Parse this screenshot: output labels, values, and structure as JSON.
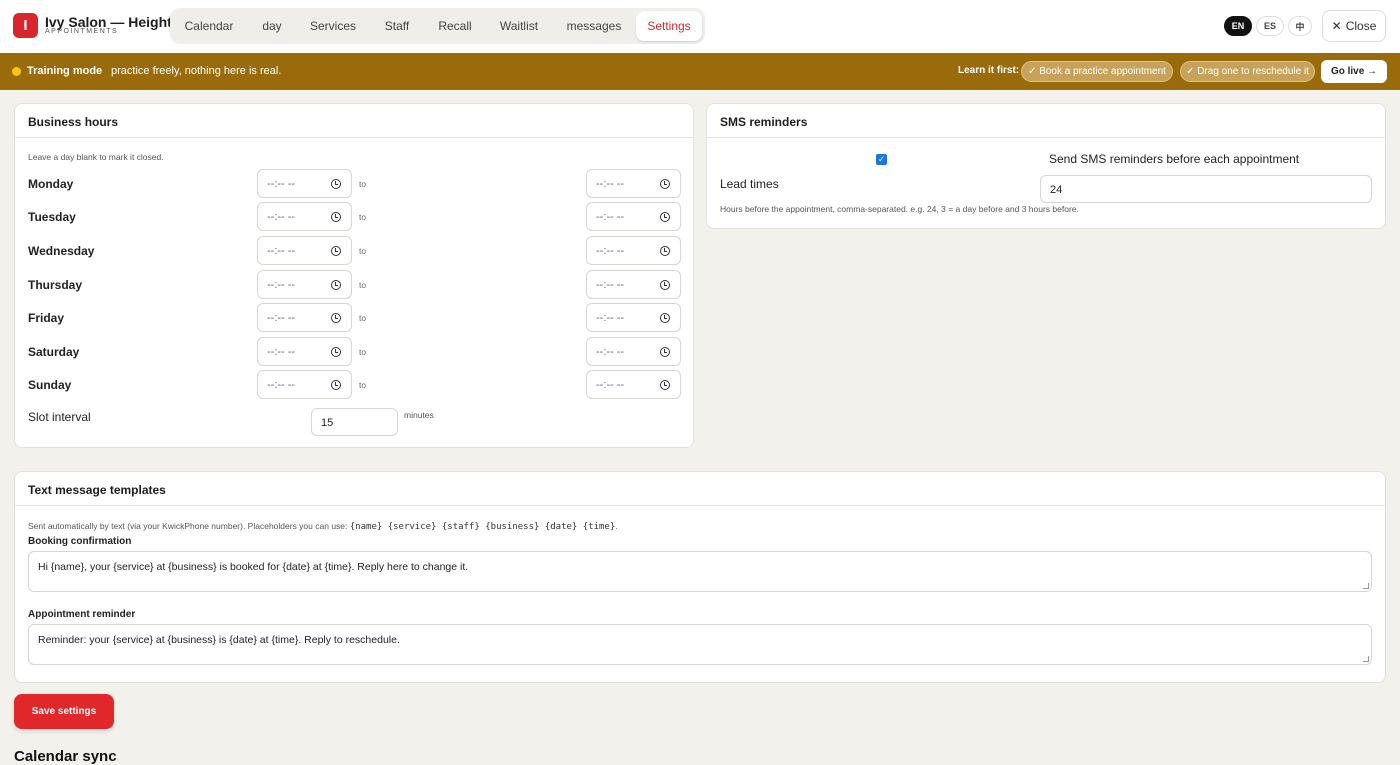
{
  "app": {
    "logo_letter": "I",
    "title": "Ivy Salon — Heights",
    "subtitle": "APPOINTMENTS",
    "accent_color": "#d8262c"
  },
  "nav": {
    "tabs": [
      {
        "label": "Calendar"
      },
      {
        "label": "day"
      },
      {
        "label": "Services"
      },
      {
        "label": "Staff"
      },
      {
        "label": "Recall"
      },
      {
        "label": "Waitlist"
      },
      {
        "label": "messages"
      },
      {
        "label": "Settings",
        "active": true
      }
    ],
    "languages": [
      {
        "label": "EN",
        "active": true
      },
      {
        "label": "ES"
      },
      {
        "label": "中"
      }
    ],
    "close_label": "Close",
    "close_icon": "close-icon"
  },
  "banner": {
    "mode_label": "Training mode",
    "text": "practice freely, nothing here is real.",
    "learn_label": "Learn it first:",
    "chips": [
      {
        "label": "✓ Book a practice appointment"
      },
      {
        "label": "✓ Drag one to reschedule it"
      }
    ],
    "go_live_label": "Go live →",
    "color": "#9a6b0a"
  },
  "business_hours": {
    "title": "Business hours",
    "hint": "Leave a day blank to mark it closed.",
    "to_label": "to",
    "time_placeholder": "--:-- --",
    "days": [
      {
        "label": "Monday"
      },
      {
        "label": "Tuesday"
      },
      {
        "label": "Wednesday"
      },
      {
        "label": "Thursday"
      },
      {
        "label": "Friday"
      },
      {
        "label": "Saturday"
      },
      {
        "label": "Sunday"
      }
    ],
    "slot_interval_label": "Slot interval",
    "slot_interval_value": "15",
    "slot_interval_unit": "minutes"
  },
  "sms_reminders": {
    "title": "SMS reminders",
    "checkbox_checked": true,
    "checkbox_label": "Send SMS reminders before each appointment",
    "lead_times_label": "Lead times",
    "lead_times_value": "24",
    "lead_times_hint": "Hours before the appointment, comma-separated. e.g. 24, 3 = a day before and 3 hours before."
  },
  "templates": {
    "title": "Text message templates",
    "hint": "Sent automatically by text (via your KwickPhone number). Placeholders you can use:",
    "placeholders": "{name} {service} {staff} {business} {date} {time}",
    "hint_end": ".",
    "booking_label": "Booking confirmation",
    "booking_value": "Hi {name}, your {service} at {business} is booked for {date} at {time}. Reply here to change it.",
    "reminder_label": "Appointment reminder",
    "reminder_value": "Reminder: your {service} at {business} is {date} at {time}. Reply to reschedule."
  },
  "save_label": "Save settings",
  "calendar_sync_title": "Calendar sync"
}
